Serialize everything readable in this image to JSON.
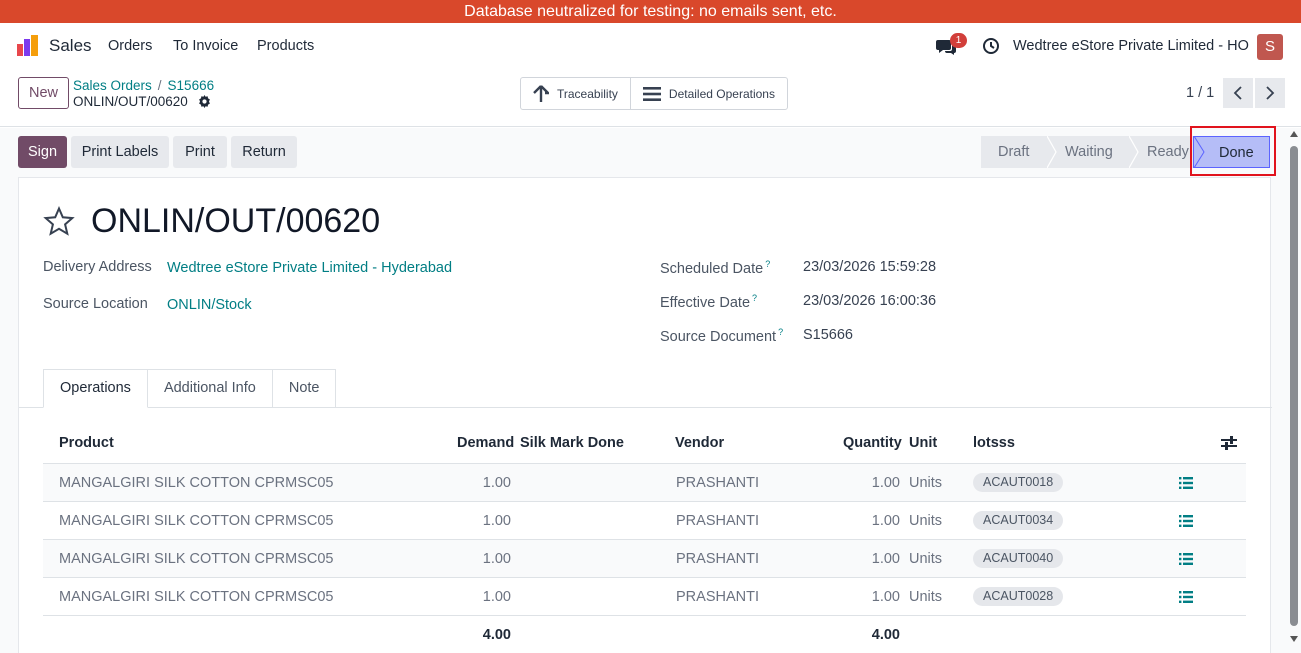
{
  "banner": "Database neutralized for testing: no emails sent, etc.",
  "nav": {
    "app_name": "Sales",
    "menu": [
      "Orders",
      "To Invoice",
      "Products"
    ],
    "chat_count": "1",
    "company": "Wedtree eStore Private Limited - HO",
    "avatar_letter": "S"
  },
  "control": {
    "new_label": "New",
    "breadcrumb": [
      "Sales Orders",
      "S15666"
    ],
    "record_name": "ONLIN/OUT/00620",
    "smart_buttons": [
      "Traceability",
      "Detailed Operations"
    ],
    "pager": "1 / 1"
  },
  "actions": [
    "Sign",
    "Print Labels",
    "Print",
    "Return"
  ],
  "status": {
    "stages": [
      "Draft",
      "Waiting",
      "Ready",
      "Done"
    ],
    "current": "Done"
  },
  "form": {
    "title": "ONLIN/OUT/00620",
    "delivery_address_label": "Delivery Address",
    "delivery_address": "Wedtree eStore Private Limited - Hyderabad",
    "source_location_label": "Source Location",
    "source_location": "ONLIN/Stock",
    "scheduled_date_label": "Scheduled Date",
    "scheduled_date": "23/03/2026 15:59:28",
    "effective_date_label": "Effective Date",
    "effective_date": "23/03/2026 16:00:36",
    "source_document_label": "Source Document",
    "source_document": "S15666",
    "help_mark": "?"
  },
  "tabs": [
    "Operations",
    "Additional Info",
    "Note"
  ],
  "table": {
    "headers": [
      "Product",
      "Demand",
      "Silk Mark Done",
      "Vendor",
      "Quantity",
      "Unit",
      "lotsss"
    ],
    "rows": [
      {
        "product": "MANGALGIRI SILK COTTON CPRMSC05",
        "demand": "1.00",
        "vendor": "PRASHANTI",
        "quantity": "1.00",
        "unit": "Units",
        "lot": "ACAUT0018"
      },
      {
        "product": "MANGALGIRI SILK COTTON CPRMSC05",
        "demand": "1.00",
        "vendor": "PRASHANTI",
        "quantity": "1.00",
        "unit": "Units",
        "lot": "ACAUT0034"
      },
      {
        "product": "MANGALGIRI SILK COTTON CPRMSC05",
        "demand": "1.00",
        "vendor": "PRASHANTI",
        "quantity": "1.00",
        "unit": "Units",
        "lot": "ACAUT0040"
      },
      {
        "product": "MANGALGIRI SILK COTTON CPRMSC05",
        "demand": "1.00",
        "vendor": "PRASHANTI",
        "quantity": "1.00",
        "unit": "Units",
        "lot": "ACAUT0028"
      }
    ],
    "total_demand": "4.00",
    "total_quantity": "4.00"
  }
}
